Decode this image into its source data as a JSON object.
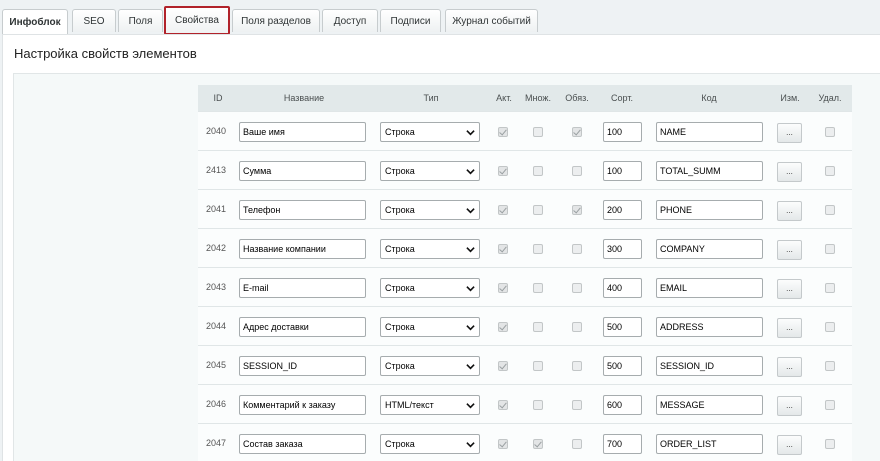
{
  "tabs": [
    {
      "label": "Инфоблок"
    },
    {
      "label": "SEO"
    },
    {
      "label": "Поля"
    },
    {
      "label": "Свойства"
    },
    {
      "label": "Поля разделов"
    },
    {
      "label": "Доступ"
    },
    {
      "label": "Подписи"
    },
    {
      "label": "Журнал событий"
    }
  ],
  "page": {
    "title": "Настройка свойств элементов"
  },
  "table": {
    "headers": {
      "id": "ID",
      "name": "Название",
      "type": "Тип",
      "active": "Акт.",
      "multiple": "Множ.",
      "required": "Обяз.",
      "sort": "Сорт.",
      "code": "Код",
      "edit": "Изм.",
      "delete": "Удал."
    },
    "edit_button_label": "...",
    "rows": [
      {
        "id": "2040",
        "name": "Ваше имя",
        "type": "Строка",
        "active": true,
        "multiple": false,
        "required": true,
        "sort": "100",
        "code": "NAME",
        "delete": false
      },
      {
        "id": "2413",
        "name": "Сумма",
        "type": "Строка",
        "active": true,
        "multiple": false,
        "required": false,
        "sort": "100",
        "code": "TOTAL_SUMM",
        "delete": false
      },
      {
        "id": "2041",
        "name": "Телефон",
        "type": "Строка",
        "active": true,
        "multiple": false,
        "required": true,
        "sort": "200",
        "code": "PHONE",
        "delete": false
      },
      {
        "id": "2042",
        "name": "Название компании",
        "type": "Строка",
        "active": true,
        "multiple": false,
        "required": false,
        "sort": "300",
        "code": "COMPANY",
        "delete": false
      },
      {
        "id": "2043",
        "name": "E-mail",
        "type": "Строка",
        "active": true,
        "multiple": false,
        "required": false,
        "sort": "400",
        "code": "EMAIL",
        "delete": false
      },
      {
        "id": "2044",
        "name": "Адрес доставки",
        "type": "Строка",
        "active": true,
        "multiple": false,
        "required": false,
        "sort": "500",
        "code": "ADDRESS",
        "delete": false
      },
      {
        "id": "2045",
        "name": "SESSION_ID",
        "type": "Строка",
        "active": true,
        "multiple": false,
        "required": false,
        "sort": "500",
        "code": "SESSION_ID",
        "delete": false
      },
      {
        "id": "2046",
        "name": "Комментарий к заказу",
        "type": "HTML/текст",
        "active": true,
        "multiple": false,
        "required": false,
        "sort": "600",
        "code": "MESSAGE",
        "delete": false
      },
      {
        "id": "2047",
        "name": "Состав заказа",
        "type": "Строка",
        "active": true,
        "multiple": true,
        "required": false,
        "sort": "700",
        "code": "ORDER_LIST",
        "delete": false
      }
    ]
  }
}
